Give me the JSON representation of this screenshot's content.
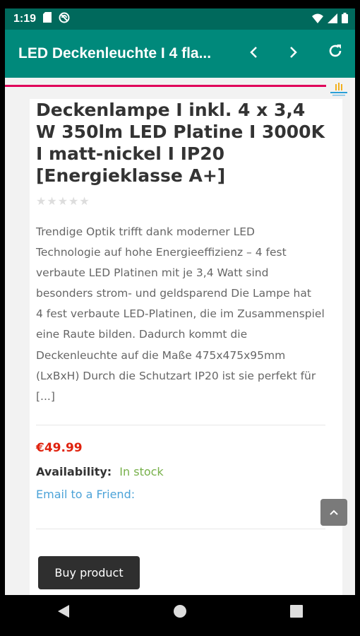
{
  "status": {
    "time": "1:19",
    "icons": [
      "sd-card-icon",
      "no-cast-icon",
      "wifi-icon",
      "signal-icon",
      "battery-icon"
    ]
  },
  "appbar": {
    "title": "LED Deckenleuchte I 4 fla...",
    "back_icon": "chevron-left-icon",
    "forward_icon": "chevron-right-icon",
    "reload_icon": "refresh-icon"
  },
  "product": {
    "title_lines": [
      "Deckenlampe I inkl. 4 x 3,4",
      "W 350lm LED Platine I 3000K",
      "I matt-nickel I IP20",
      "[Energieklasse A+]"
    ],
    "rating_stars": 0,
    "description_lines": [
      "Trendige Optik trifft dank moderner LED",
      "Technologie auf hohe Energieeffizienz – 4 fest",
      "verbaute LED Platinen mit je 3,4 Watt sind",
      "besonders strom- und geldsparend Die Lampe hat",
      "4 fest verbaute LED-Platinen, die im Zusammenspiel",
      "eine Raute bilden. Dadurch kommt die",
      "Deckenleuchte auf die Maße 475x475x95mm",
      "(LxBxH) Durch die Schutzart IP20 ist sie perfekt für",
      "[...]"
    ],
    "price": "€49.99",
    "availability_label": "Availability:",
    "availability_value": "In stock",
    "email_link": "Email to a Friend:",
    "buy_label": "Buy product"
  },
  "colors": {
    "statusbar": "#00695c",
    "appbar": "#00897b",
    "progress": "#e0005a",
    "price": "#e0220e",
    "in_stock": "#77b04a",
    "link": "#4ca3d8"
  }
}
